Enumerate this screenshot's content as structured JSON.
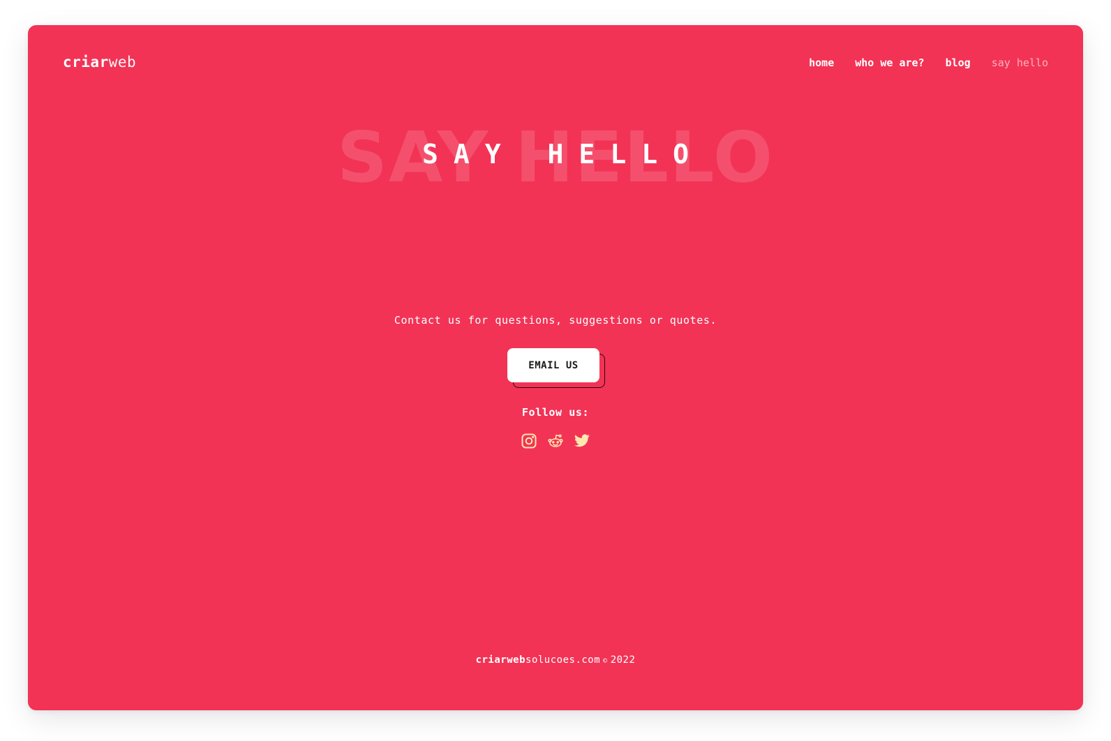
{
  "brand": {
    "logo_bold": "criar",
    "logo_light": "web"
  },
  "nav": {
    "items": [
      {
        "label": "home"
      },
      {
        "label": "who we are?"
      },
      {
        "label": "blog"
      },
      {
        "label": "say hello",
        "active": true
      }
    ]
  },
  "hero": {
    "ghost_title": "SAY HELLO",
    "title": "SAY HELLO"
  },
  "contact": {
    "text": "Contact us for questions, suggestions or quotes.",
    "button_label": "EMAIL US",
    "follow_label": "Follow us:"
  },
  "socials": [
    {
      "icon": "instagram-icon"
    },
    {
      "icon": "reddit-icon"
    },
    {
      "icon": "twitter-icon"
    }
  ],
  "footer": {
    "domain_bold": "criarweb",
    "domain_rest": "solucoes.com",
    "copyright_symbol": "©",
    "year": "2022"
  },
  "colors": {
    "background": "#f23356",
    "ghost_text": "#f4506d",
    "nav_active": "#ffb3bb",
    "icon": "#ffe8b0",
    "button_bg": "#ffffff"
  }
}
